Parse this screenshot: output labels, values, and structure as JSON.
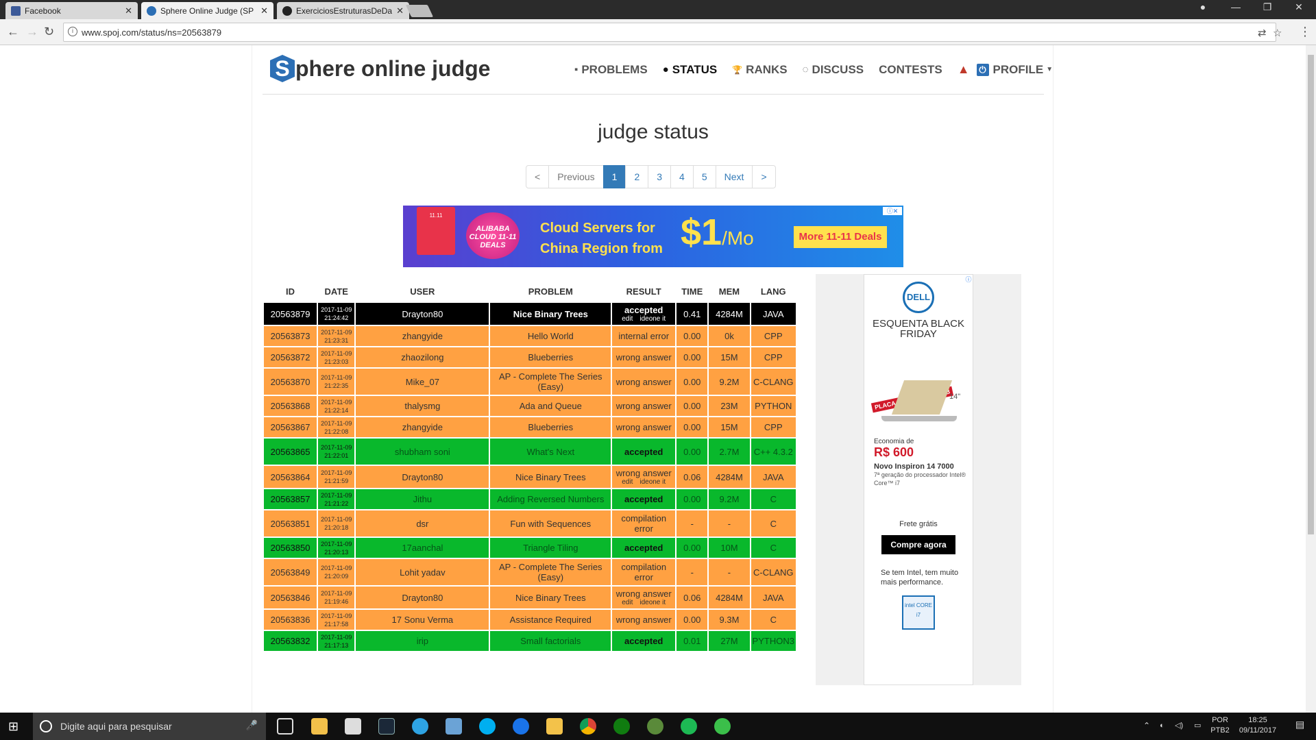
{
  "browser": {
    "tabs": [
      {
        "title": "Facebook",
        "color": "#3b5998"
      },
      {
        "title": "Sphere Online Judge (SP",
        "color": "#2c6fb5"
      },
      {
        "title": "ExerciciosEstruturasDeDa",
        "color": "#222222"
      }
    ],
    "url": "www.spoj.com/status/ns=20563879"
  },
  "site": {
    "logo_letter": "S",
    "logo_text": "phere online judge",
    "nav": [
      {
        "icon": "puzzle-icon",
        "glyph": "▪",
        "label": "PROBLEMS"
      },
      {
        "icon": "circle-icon",
        "glyph": "●",
        "label": "STATUS"
      },
      {
        "icon": "trophy-icon",
        "glyph": "🏆",
        "label": "RANKS"
      },
      {
        "icon": "comments-icon",
        "glyph": "◌",
        "label": "DISCUSS"
      },
      {
        "icon": "",
        "glyph": "",
        "label": "CONTESTS"
      }
    ],
    "profile_label": "PROFILE",
    "heading": "judge status",
    "pager": [
      "<",
      "Previous",
      "1",
      "2",
      "3",
      "4",
      "5",
      "Next",
      ">"
    ]
  },
  "banner": {
    "brand_small": "11.11",
    "deal": "ALIBABA CLOUD 11-11 DEALS",
    "line1": "Cloud Servers for",
    "line2": "China Region from",
    "price": "$1",
    "per": "/Mo",
    "cta": "More 11-11 Deals"
  },
  "table": {
    "headers": [
      "ID",
      "DATE",
      "USER",
      "PROBLEM",
      "RESULT",
      "TIME",
      "MEM",
      "LANG"
    ],
    "rows": [
      {
        "style": "black",
        "id": "20563879",
        "d1": "2017-11-09",
        "d2": "21:24:42",
        "user": "Drayton80",
        "problem": "Nice Binary Trees",
        "result": "accepted",
        "sub": true,
        "time": "0.41",
        "mem": "4284M",
        "lang": "JAVA"
      },
      {
        "style": "orange",
        "id": "20563873",
        "d1": "2017-11-09",
        "d2": "21:23:31",
        "user": "zhangyide",
        "problem": "Hello World",
        "result": "internal error",
        "sub": false,
        "time": "0.00",
        "mem": "0k",
        "lang": "CPP"
      },
      {
        "style": "orange",
        "id": "20563872",
        "d1": "2017-11-09",
        "d2": "21:23:03",
        "user": "zhaozilong",
        "problem": "Blueberries",
        "result": "wrong answer",
        "sub": false,
        "time": "0.00",
        "mem": "15M",
        "lang": "CPP"
      },
      {
        "style": "orange",
        "id": "20563870",
        "d1": "2017-11-09",
        "d2": "21:22:35",
        "user": "Mike_07",
        "problem": "AP - Complete The Series (Easy)",
        "result": "wrong answer",
        "sub": false,
        "time": "0.00",
        "mem": "9.2M",
        "lang": "C-CLANG"
      },
      {
        "style": "orange",
        "id": "20563868",
        "d1": "2017-11-09",
        "d2": "21:22:14",
        "user": "thalysmg",
        "problem": "Ada and Queue",
        "result": "wrong answer",
        "sub": false,
        "time": "0.00",
        "mem": "23M",
        "lang": "PYTHON"
      },
      {
        "style": "orange",
        "id": "20563867",
        "d1": "2017-11-09",
        "d2": "21:22:08",
        "user": "zhangyide",
        "problem": "Blueberries",
        "result": "wrong answer",
        "sub": false,
        "time": "0.00",
        "mem": "15M",
        "lang": "CPP"
      },
      {
        "style": "green",
        "id": "20563865",
        "d1": "2017-11-09",
        "d2": "21:22:01",
        "user": "shubham soni",
        "problem": "What's Next",
        "result": "accepted",
        "sub": false,
        "time": "0.00",
        "mem": "2.7M",
        "lang": "C++ 4.3.2"
      },
      {
        "style": "orange",
        "id": "20563864",
        "d1": "2017-11-09",
        "d2": "21:21:59",
        "user": "Drayton80",
        "problem": "Nice Binary Trees",
        "result": "wrong answer",
        "sub": true,
        "time": "0.06",
        "mem": "4284M",
        "lang": "JAVA"
      },
      {
        "style": "green",
        "id": "20563857",
        "d1": "2017-11-09",
        "d2": "21:21:22",
        "user": "Jithu",
        "problem": "Adding Reversed Numbers",
        "result": "accepted",
        "sub": false,
        "time": "0.00",
        "mem": "9.2M",
        "lang": "C"
      },
      {
        "style": "orange",
        "id": "20563851",
        "d1": "2017-11-09",
        "d2": "21:20:18",
        "user": "dsr",
        "problem": "Fun with Sequences",
        "result": "compilation error",
        "sub": false,
        "time": "-",
        "mem": "-",
        "lang": "C"
      },
      {
        "style": "green",
        "id": "20563850",
        "d1": "2017-11-09",
        "d2": "21:20:13",
        "user": "17aanchal",
        "problem": "Triangle Tiling",
        "result": "accepted",
        "sub": false,
        "time": "0.00",
        "mem": "10M",
        "lang": "C"
      },
      {
        "style": "orange",
        "id": "20563849",
        "d1": "2017-11-09",
        "d2": "21:20:09",
        "user": "Lohit yadav",
        "problem": "AP - Complete The Series (Easy)",
        "result": "compilation error",
        "sub": false,
        "time": "-",
        "mem": "-",
        "lang": "C-CLANG"
      },
      {
        "style": "orange",
        "id": "20563846",
        "d1": "2017-11-09",
        "d2": "21:19:46",
        "user": "Drayton80",
        "problem": "Nice Binary Trees",
        "result": "wrong answer",
        "sub": true,
        "time": "0.06",
        "mem": "4284M",
        "lang": "JAVA"
      },
      {
        "style": "orange",
        "id": "20563836",
        "d1": "2017-11-09",
        "d2": "21:17:58",
        "user": "17 Sonu Verma",
        "problem": "Assistance Required",
        "result": "wrong answer",
        "sub": false,
        "time": "0.00",
        "mem": "9.3M",
        "lang": "C"
      },
      {
        "style": "green",
        "id": "20563832",
        "d1": "2017-11-09",
        "d2": "21:17:13",
        "user": "irip",
        "problem": "Small factorials",
        "result": "accepted",
        "sub": false,
        "time": "0.01",
        "mem": "27M",
        "lang": "PYTHON3"
      }
    ],
    "sub_links": [
      "edit",
      "ideone it"
    ]
  },
  "sidead": {
    "brand": "DELL",
    "title": "ESQUENTA BLACK FRIDAY",
    "badge": "PLACA DE VÍDEO DE 4GB",
    "size": "14\"",
    "eco": "Economia de",
    "price": "R$ 600",
    "model": "Novo Inspiron 14 7000",
    "gen": "7ª geração do processador Intel® Core™ i7",
    "frete": "Frete grátis",
    "cta": "Compre agora",
    "intel": "Se tem Intel, tem muito mais performance.",
    "chip": "intel CORE i7"
  },
  "taskbar": {
    "search_placeholder": "Digite aqui para pesquisar",
    "lang1": "POR",
    "lang2": "PTB2",
    "time": "18:25",
    "date": "09/11/2017"
  }
}
